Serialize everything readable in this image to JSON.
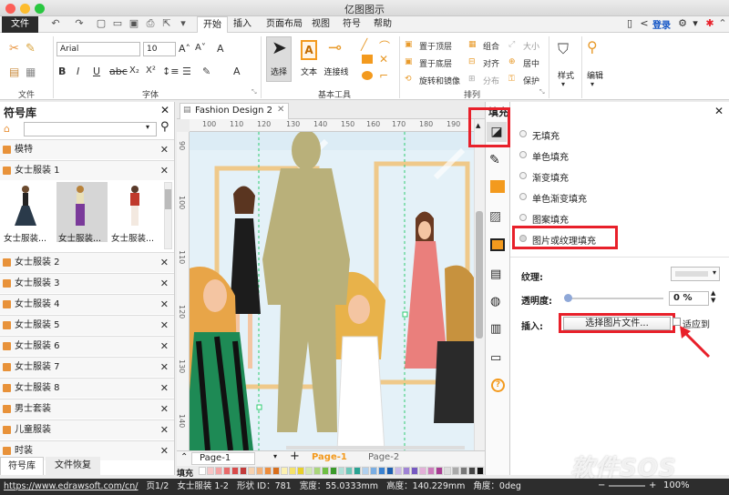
{
  "window": {
    "title": "亿图图示"
  },
  "menu": {
    "file": "文件",
    "tabs": [
      "开始",
      "插入",
      "页面布局",
      "视图",
      "符号",
      "帮助"
    ],
    "login": "登录"
  },
  "ribbon": {
    "groups": [
      "文件",
      "字体",
      "基本工具",
      "排列"
    ],
    "font_name": "Arial",
    "font_size": "10",
    "tools": {
      "select": "选择",
      "text": "文本",
      "connector": "连接线"
    },
    "arrange": {
      "to_top": "置于顶层",
      "to_bottom": "置于底层",
      "rotate": "旋转和镜像",
      "group": "组合",
      "align": "对齐",
      "distribute": "分布",
      "size": "大小",
      "center": "居中",
      "protect": "保护"
    },
    "style": "样式",
    "edit": "编辑"
  },
  "library": {
    "title": "符号库",
    "search_value": "",
    "category_top": "模特",
    "open_category": "女士服装 1",
    "thumbs": [
      "女士服装...",
      "女士服装...",
      "女士服装..."
    ],
    "categories": [
      "女士服装 2",
      "女士服装 3",
      "女士服装 4",
      "女士服装 5",
      "女士服装 6",
      "女士服装 7",
      "女士服装 8",
      "男士套装",
      "儿童服装",
      "时装"
    ],
    "bottom_tabs": [
      "符号库",
      "文件恢复"
    ]
  },
  "document": {
    "tab": "Fashion Design 2",
    "ruler_h": [
      "100",
      "110",
      "120",
      "130",
      "140",
      "150",
      "160",
      "170",
      "180",
      "190"
    ],
    "ruler_v": [
      "90",
      "100",
      "110",
      "120",
      "130",
      "140"
    ],
    "pages": [
      "Page-1",
      "Page-1",
      "Page-2"
    ],
    "fill_label": "填充"
  },
  "fill_panel": {
    "title": "填充",
    "options": [
      "无填充",
      "单色填充",
      "渐变填充",
      "单色渐变填充",
      "图案填充",
      "图片或纹理填充"
    ],
    "selected": "图片或纹理填充",
    "texture_label": "纹理:",
    "opacity_label": "透明度:",
    "opacity_value": "0 %",
    "insert_label": "插入:",
    "choose_button": "选择图片文件...",
    "fit_label": "适应到"
  },
  "status": {
    "url": "https://www.edrawsoft.com/cn/",
    "page": "页1/2",
    "shape": "女士服装 1-2",
    "shape_id": "形状 ID：781",
    "width": "宽度：55.0333mm",
    "height": "高度：140.229mm",
    "angle": "角度：0deg",
    "zoom": "100%"
  },
  "watermark": "软件SOS",
  "colors": {
    "accent_red": "#e8202a",
    "panel_orange": "#f39a1e",
    "fill_texture": "#b9b07a"
  }
}
